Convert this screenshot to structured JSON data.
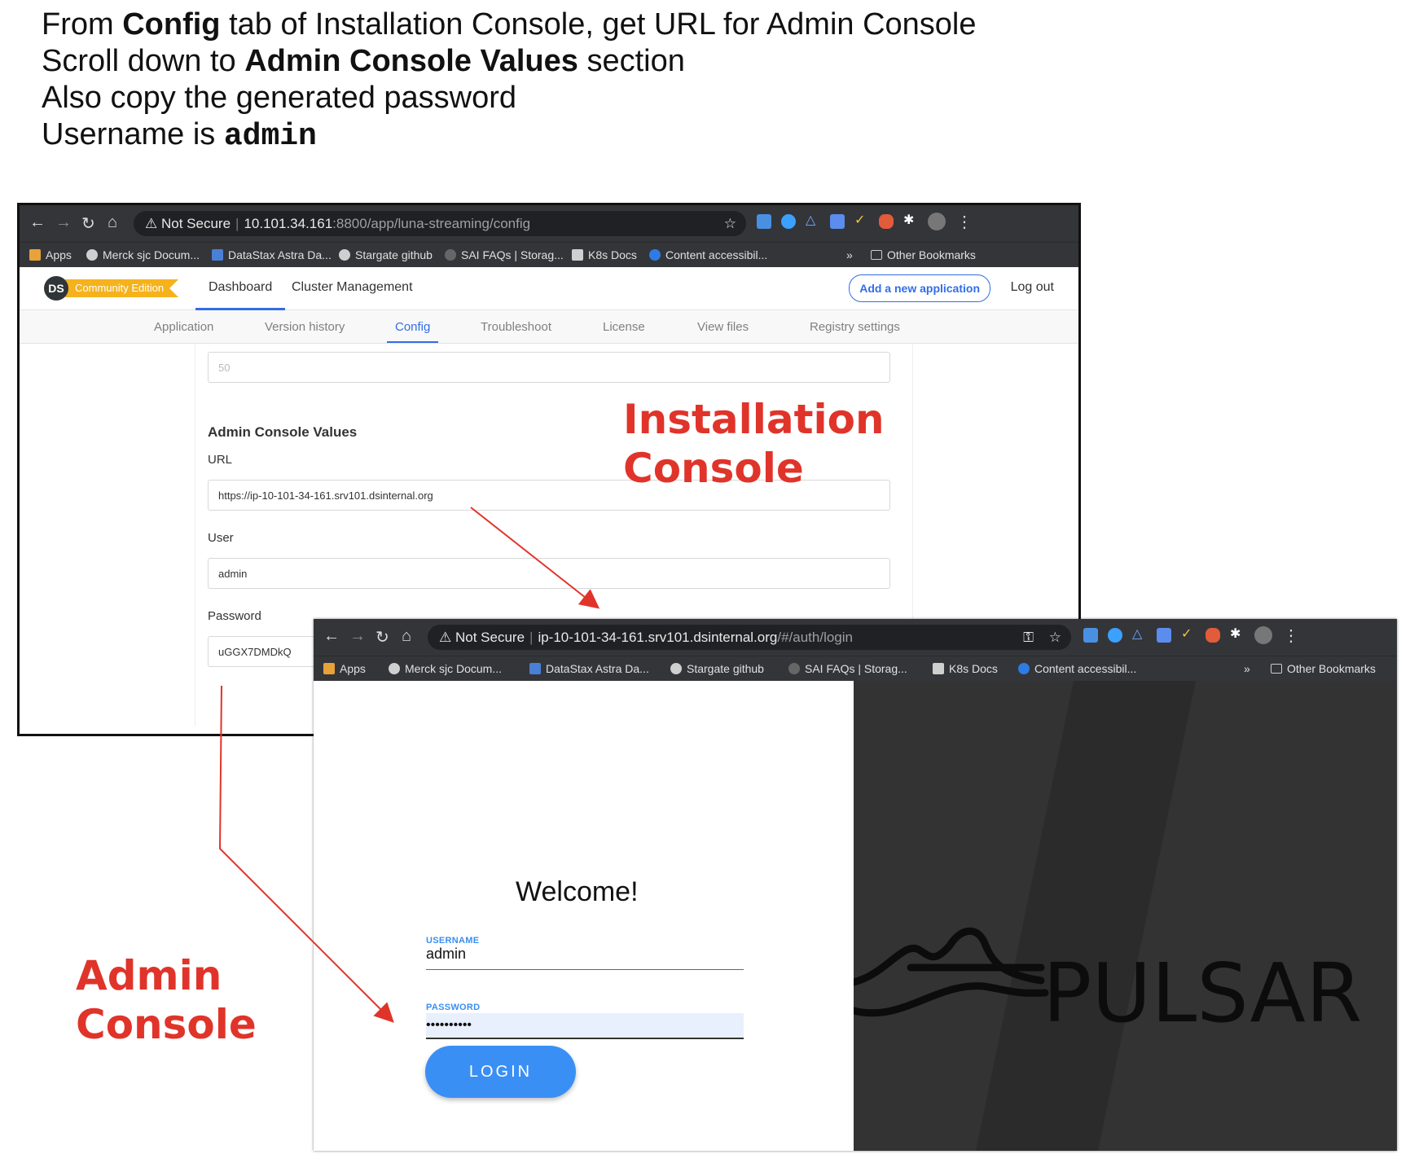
{
  "instructions": {
    "line1_pre": "From ",
    "line1_bold": "Config",
    "line1_post": " tab of Installation Console, get URL for Admin Console",
    "line2_pre": "Scroll down to ",
    "line2_bold": "Admin Console Values",
    "line2_post": " section",
    "line3": "Also copy the generated password",
    "line4_pre": "Username is ",
    "line4_code": "admin"
  },
  "callouts": {
    "installation_line1": "Installation",
    "installation_line2": "Console",
    "admin_line1": "Admin",
    "admin_line2": "Console"
  },
  "bookmarks": {
    "apps": "Apps",
    "merck": "Merck sjc Docum...",
    "datastax": "DataStax Astra Da...",
    "stargate": "Stargate github",
    "sai": "SAI FAQs | Storag...",
    "k8s": "K8s Docs",
    "content": "Content accessibil...",
    "overflow": "»",
    "other": "Other Bookmarks"
  },
  "install_console": {
    "url_not_secure": "Not Secure",
    "url_host": "10.101.34.161",
    "url_path": ":8800/app/luna-streaming/config",
    "logo": "DS",
    "edition": "Community Edition",
    "nav": {
      "dashboard": "Dashboard",
      "cluster": "Cluster Management",
      "add_app": "Add a new application",
      "logout": "Log out"
    },
    "tabs": {
      "application": "Application",
      "version_history": "Version history",
      "config": "Config",
      "troubleshoot": "Troubleshoot",
      "license": "License",
      "view_files": "View files",
      "registry": "Registry settings"
    },
    "prev_field_value": "50",
    "section_title": "Admin Console Values",
    "url_label": "URL",
    "url_value": "https://ip-10-101-34-161.srv101.dsinternal.org",
    "user_label": "User",
    "user_value": "admin",
    "password_label": "Password",
    "password_value": "uGGX7DMDkQ"
  },
  "admin_console": {
    "url_not_secure": "Not Secure",
    "url_host": "ip-10-101-34-161.srv101.dsinternal.org",
    "url_path": "/#/auth/login",
    "welcome": "Welcome!",
    "username_label": "USERNAME",
    "username_value": "admin",
    "password_label": "PASSWORD",
    "password_value": "••••••••••",
    "login_button": "LOGIN",
    "brand": "PULSAR"
  },
  "colors": {
    "accent_blue": "#326de6",
    "callout_red": "#e0342a",
    "login_blue": "#3a8ff5",
    "dark_panel": "#333333"
  }
}
